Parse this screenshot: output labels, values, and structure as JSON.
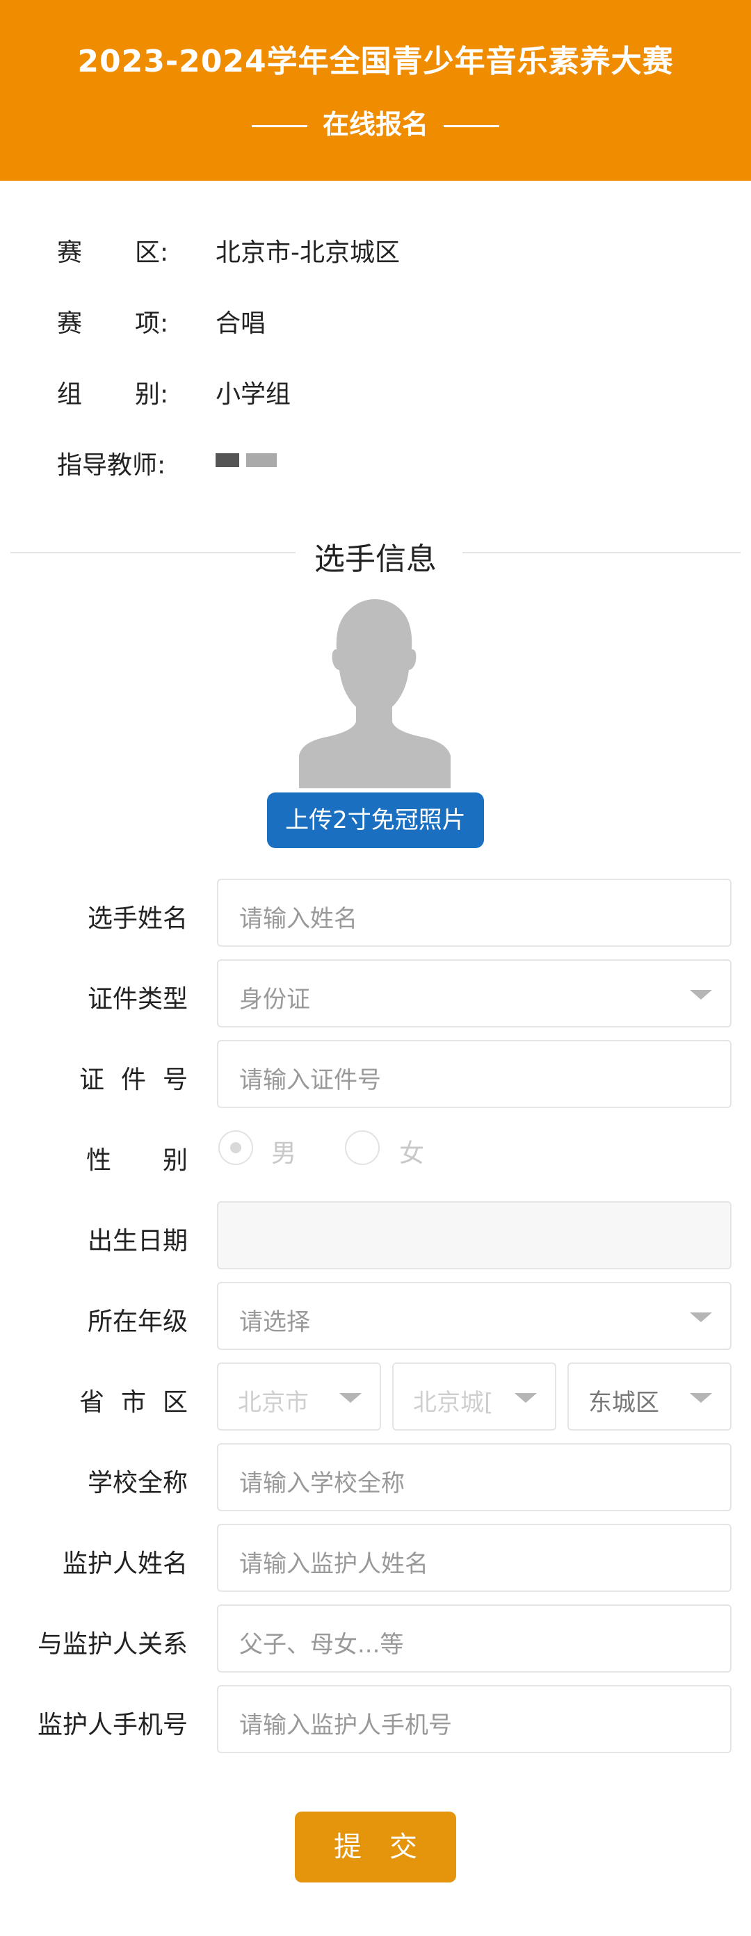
{
  "header": {
    "title": "2023-2024学年全国青少年音乐素养大赛",
    "subtitle": "在线报名"
  },
  "info": {
    "region": {
      "label_a": "赛",
      "label_b": "区:",
      "value": "北京市-北京城区"
    },
    "event": {
      "label_a": "赛",
      "label_b": "项:",
      "value": "合唱"
    },
    "group": {
      "label_a": "组",
      "label_b": "别:",
      "value": "小学组"
    },
    "teacher": {
      "label": "指导教师:"
    }
  },
  "section_title": "选手信息",
  "upload_label": "上传2寸免冠照片",
  "form": {
    "name": {
      "label": "选手姓名",
      "placeholder": "请输入姓名"
    },
    "id_type": {
      "label": "证件类型",
      "value": "身份证"
    },
    "id_number": {
      "label_chars": [
        "证",
        "件",
        "号"
      ],
      "placeholder": "请输入证件号"
    },
    "gender": {
      "label_chars": [
        "性",
        "别"
      ],
      "options": [
        "男",
        "女"
      ],
      "selected": "男"
    },
    "birth": {
      "label": "出生日期",
      "value": ""
    },
    "grade": {
      "label": "所在年级",
      "placeholder": "请选择"
    },
    "area": {
      "label_chars": [
        "省",
        "市",
        "区"
      ],
      "province": "北京市",
      "city": "北京城[",
      "district": "东城区"
    },
    "school": {
      "label": "学校全称",
      "placeholder": "请输入学校全称"
    },
    "guardian_name": {
      "label": "监护人姓名",
      "placeholder": "请输入监护人姓名"
    },
    "relation": {
      "label": "与监护人关系",
      "placeholder": "父子、母女...等"
    },
    "guardian_phone": {
      "label": "监护人手机号",
      "placeholder": "请输入监护人手机号"
    }
  },
  "submit_label": "提交",
  "colors": {
    "header": "#f08c00",
    "upload": "#1a6fc0",
    "submit": "#e5950b"
  }
}
